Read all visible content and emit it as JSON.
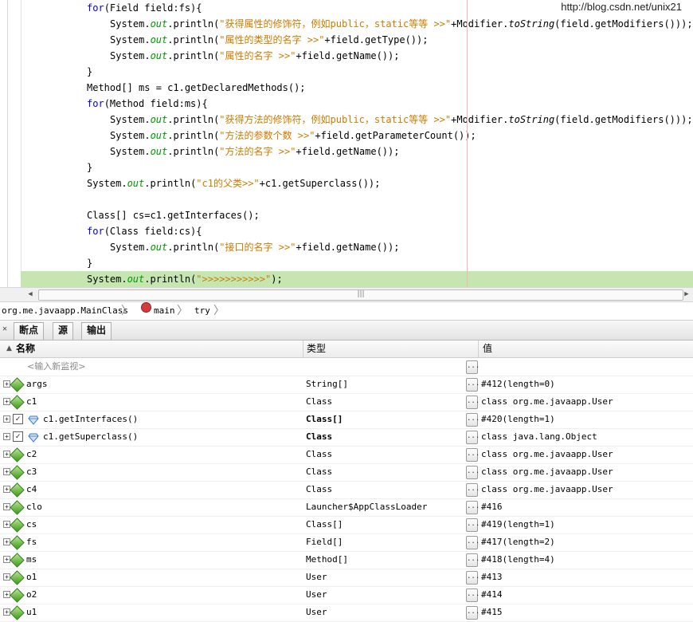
{
  "editor": {
    "watermark": "http://blog.csdn.net/unix21",
    "lines": [
      {
        "segs": [
          {
            "t": "for",
            "c": "kw"
          },
          {
            "t": "(Field field:fs){"
          }
        ]
      },
      {
        "segs": [
          {
            "t": "System."
          },
          {
            "t": "out",
            "c": "out"
          },
          {
            "t": ".println("
          },
          {
            "t": "\"获得属性的修饰符，例如public，static等等 >>\"",
            "c": "str"
          },
          {
            "t": "+Modifier."
          },
          {
            "t": "toString",
            "c": "ital"
          },
          {
            "t": "(field.getModifiers()));"
          }
        ]
      },
      {
        "segs": [
          {
            "t": "System."
          },
          {
            "t": "out",
            "c": "out"
          },
          {
            "t": ".println("
          },
          {
            "t": "\"属性的类型的名字 >>\"",
            "c": "str"
          },
          {
            "t": "+field.getType());"
          }
        ]
      },
      {
        "segs": [
          {
            "t": "System."
          },
          {
            "t": "out",
            "c": "out"
          },
          {
            "t": ".println("
          },
          {
            "t": "\"属性的名字 >>\"",
            "c": "str"
          },
          {
            "t": "+field.getName());"
          }
        ]
      },
      {
        "segs": [
          {
            "t": "}"
          }
        ]
      },
      {
        "segs": [
          {
            "t": "Method[] ms = c1.getDeclaredMethods();"
          }
        ]
      },
      {
        "segs": [
          {
            "t": "for",
            "c": "kw"
          },
          {
            "t": "(Method field:ms){"
          }
        ]
      },
      {
        "segs": [
          {
            "t": "System."
          },
          {
            "t": "out",
            "c": "out"
          },
          {
            "t": ".println("
          },
          {
            "t": "\"获得方法的修饰符，例如public，static等等 >>\"",
            "c": "str"
          },
          {
            "t": "+Modifier."
          },
          {
            "t": "toString",
            "c": "ital"
          },
          {
            "t": "(field.getModifiers()));"
          }
        ]
      },
      {
        "segs": [
          {
            "t": "System."
          },
          {
            "t": "out",
            "c": "out"
          },
          {
            "t": ".println("
          },
          {
            "t": "\"方法的参数个数 >>\"",
            "c": "str"
          },
          {
            "t": "+field.getParameterCount());"
          }
        ]
      },
      {
        "segs": [
          {
            "t": "System."
          },
          {
            "t": "out",
            "c": "out"
          },
          {
            "t": ".println("
          },
          {
            "t": "\"方法的名字 >>\"",
            "c": "str"
          },
          {
            "t": "+field.getName());"
          }
        ]
      },
      {
        "segs": [
          {
            "t": "}"
          }
        ]
      },
      {
        "segs": [
          {
            "t": "System."
          },
          {
            "t": "out",
            "c": "out"
          },
          {
            "t": ".println("
          },
          {
            "t": "\"c1的父类>>\"",
            "c": "str"
          },
          {
            "t": "+c1.getSuperclass());"
          }
        ]
      },
      {
        "segs": []
      },
      {
        "segs": [
          {
            "t": "Class[] cs=c1.getInterfaces();"
          }
        ]
      },
      {
        "segs": [
          {
            "t": "for",
            "c": "kw"
          },
          {
            "t": "(Class field:cs){"
          }
        ]
      },
      {
        "segs": [
          {
            "t": "System."
          },
          {
            "t": "out",
            "c": "out"
          },
          {
            "t": ".println("
          },
          {
            "t": "\"接口的名字 >>\"",
            "c": "str"
          },
          {
            "t": "+field.getName());"
          }
        ]
      },
      {
        "segs": [
          {
            "t": "}"
          }
        ]
      },
      {
        "segs": [
          {
            "t": "System."
          },
          {
            "t": "out",
            "c": "out"
          },
          {
            "t": ".println("
          },
          {
            "t": "\">>>>>>>>>>>\"",
            "c": "str"
          },
          {
            "t": ");"
          }
        ]
      }
    ]
  },
  "scrollbar": {
    "grip": "|||"
  },
  "breadcrumb": {
    "class_name": "org.me.javaapp.MainClass",
    "method": "main",
    "block": "try"
  },
  "tabs": {
    "close": "✕",
    "breakpoints": "断点",
    "sources": "源",
    "output": "输出"
  },
  "watch": {
    "headers": {
      "name": "名称",
      "type": "类型",
      "value": "值"
    },
    "sort_glyph": "▲",
    "new_watch_placeholder": "<输入新监视>",
    "rows": [
      {
        "name": "args",
        "type": "String[]",
        "value": "#412(length=0)",
        "kind": "var",
        "bold": false
      },
      {
        "name": "c1",
        "type": "Class",
        "value": "class org.me.javaapp.User",
        "kind": "var",
        "bold": false
      },
      {
        "name": "c1.getInterfaces()",
        "type": "Class[]",
        "value": "#420(length=1)",
        "kind": "watch",
        "bold": true
      },
      {
        "name": "c1.getSuperclass()",
        "type": "Class",
        "value": "class java.lang.Object",
        "kind": "watch",
        "bold": true
      },
      {
        "name": "c2",
        "type": "Class",
        "value": "class org.me.javaapp.User",
        "kind": "var",
        "bold": false
      },
      {
        "name": "c3",
        "type": "Class",
        "value": "class org.me.javaapp.User",
        "kind": "var",
        "bold": false
      },
      {
        "name": "c4",
        "type": "Class",
        "value": "class org.me.javaapp.User",
        "kind": "var",
        "bold": false
      },
      {
        "name": "clo",
        "type": "Launcher$AppClassLoader",
        "value": "#416",
        "kind": "var",
        "bold": false
      },
      {
        "name": "cs",
        "type": "Class[]",
        "value": "#419(length=1)",
        "kind": "var",
        "bold": false
      },
      {
        "name": "fs",
        "type": "Field[]",
        "value": "#417(length=2)",
        "kind": "var",
        "bold": false
      },
      {
        "name": "ms",
        "type": "Method[]",
        "value": "#418(length=4)",
        "kind": "var",
        "bold": false
      },
      {
        "name": "o1",
        "type": "User",
        "value": "#413",
        "kind": "var",
        "bold": false
      },
      {
        "name": "o2",
        "type": "User",
        "value": "#414",
        "kind": "var",
        "bold": false
      },
      {
        "name": "u1",
        "type": "User",
        "value": "#415",
        "kind": "var",
        "bold": false
      }
    ]
  }
}
